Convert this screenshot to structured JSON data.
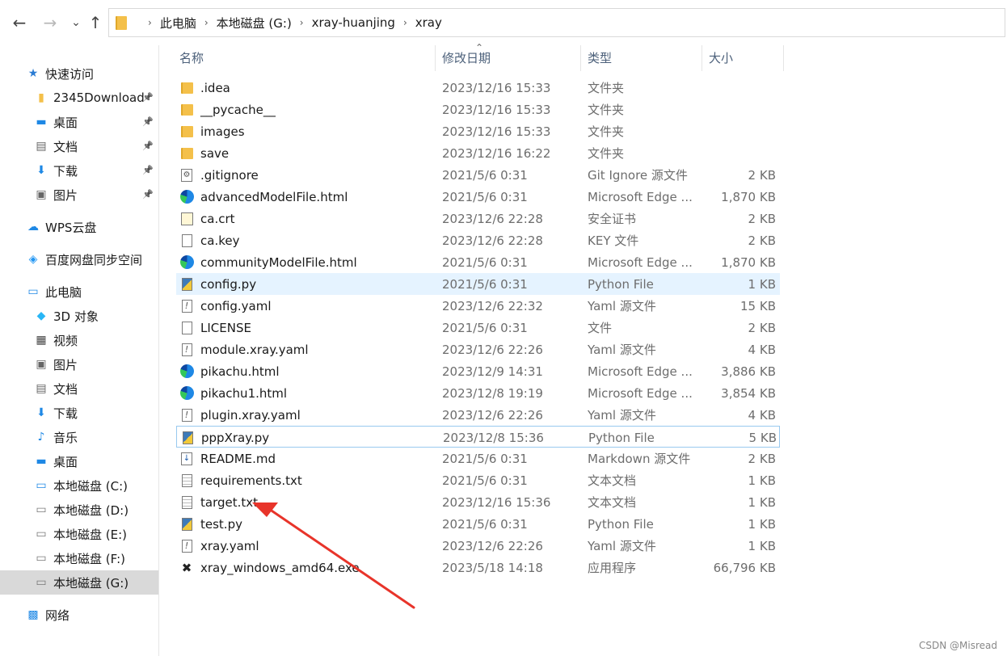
{
  "breadcrumb": [
    "此电脑",
    "本地磁盘 (G:)",
    "xray-huanjing",
    "xray"
  ],
  "nav": {
    "back": "←",
    "forward": "→",
    "recent": "⌄",
    "up": "↑"
  },
  "sidebar": {
    "items": [
      {
        "label": "快速访问",
        "icon": "star-icon",
        "glyph": "★",
        "color": "#2b7cd3",
        "indent": 32,
        "pinned": false
      },
      {
        "label": "2345Download",
        "icon": "folder-icon",
        "glyph": "▮",
        "color": "#f4c04a",
        "indent": 42,
        "pinned": true
      },
      {
        "label": "桌面",
        "icon": "desktop-icon",
        "glyph": "▬",
        "color": "#1e88e5",
        "indent": 42,
        "pinned": true
      },
      {
        "label": "文档",
        "icon": "document-icon",
        "glyph": "▤",
        "color": "#666666",
        "indent": 42,
        "pinned": true
      },
      {
        "label": "下载",
        "icon": "download-icon",
        "glyph": "⬇",
        "color": "#1e88e5",
        "indent": 42,
        "pinned": true
      },
      {
        "label": "图片",
        "icon": "picture-icon",
        "glyph": "▣",
        "color": "#666666",
        "indent": 42,
        "pinned": true
      },
      {
        "label": "WPS云盘",
        "icon": "cloud-icon",
        "glyph": "☁",
        "color": "#1e88e5",
        "indent": 32,
        "pinned": false
      },
      {
        "label": "百度网盘同步空间",
        "icon": "baidu-sync-icon",
        "glyph": "◈",
        "color": "#2196f3",
        "indent": 32,
        "pinned": false
      },
      {
        "label": "此电脑",
        "icon": "computer-icon",
        "glyph": "▭",
        "color": "#1e88e5",
        "indent": 32,
        "pinned": false
      },
      {
        "label": "3D 对象",
        "icon": "3d-objects-icon",
        "glyph": "◆",
        "color": "#29b6f6",
        "indent": 42,
        "pinned": false
      },
      {
        "label": "视频",
        "icon": "video-icon",
        "glyph": "▦",
        "color": "#444444",
        "indent": 42,
        "pinned": false
      },
      {
        "label": "图片",
        "icon": "picture-icon",
        "glyph": "▣",
        "color": "#666666",
        "indent": 42,
        "pinned": false
      },
      {
        "label": "文档",
        "icon": "document-icon",
        "glyph": "▤",
        "color": "#666666",
        "indent": 42,
        "pinned": false
      },
      {
        "label": "下载",
        "icon": "download-icon",
        "glyph": "⬇",
        "color": "#1e88e5",
        "indent": 42,
        "pinned": false
      },
      {
        "label": "音乐",
        "icon": "music-icon",
        "glyph": "♪",
        "color": "#1e88e5",
        "indent": 42,
        "pinned": false
      },
      {
        "label": "桌面",
        "icon": "desktop-icon",
        "glyph": "▬",
        "color": "#1e88e5",
        "indent": 42,
        "pinned": false
      },
      {
        "label": "本地磁盘 (C:)",
        "icon": "drive-c-icon",
        "glyph": "▭",
        "color": "#1e88e5",
        "indent": 42,
        "pinned": false
      },
      {
        "label": "本地磁盘 (D:)",
        "icon": "drive-icon",
        "glyph": "▭",
        "color": "#777777",
        "indent": 42,
        "pinned": false
      },
      {
        "label": "本地磁盘 (E:)",
        "icon": "drive-icon",
        "glyph": "▭",
        "color": "#777777",
        "indent": 42,
        "pinned": false
      },
      {
        "label": "本地磁盘 (F:)",
        "icon": "drive-icon",
        "glyph": "▭",
        "color": "#777777",
        "indent": 42,
        "pinned": false
      },
      {
        "label": "本地磁盘 (G:)",
        "icon": "drive-icon",
        "glyph": "▭",
        "color": "#777777",
        "indent": 42,
        "pinned": false,
        "selected": true
      },
      {
        "label": "网络",
        "icon": "network-icon",
        "glyph": "▩",
        "color": "#1e88e5",
        "indent": 32,
        "pinned": false
      }
    ]
  },
  "columns": {
    "name": "名称",
    "date": "修改日期",
    "type": "类型",
    "size": "大小"
  },
  "files": [
    {
      "name": ".idea",
      "date": "2023/12/16 15:33",
      "type": "文件夹",
      "size": "",
      "icon": "folder"
    },
    {
      "name": "__pycache__",
      "date": "2023/12/16 15:33",
      "type": "文件夹",
      "size": "",
      "icon": "folder"
    },
    {
      "name": "images",
      "date": "2023/12/16 15:33",
      "type": "文件夹",
      "size": "",
      "icon": "folder"
    },
    {
      "name": "save",
      "date": "2023/12/16 16:22",
      "type": "文件夹",
      "size": "",
      "icon": "folder"
    },
    {
      "name": ".gitignore",
      "date": "2021/5/6 0:31",
      "type": "Git Ignore 源文件",
      "size": "2 KB",
      "icon": "gear"
    },
    {
      "name": "advancedModelFile.html",
      "date": "2021/5/6 0:31",
      "type": "Microsoft Edge ...",
      "size": "1,870 KB",
      "icon": "edge"
    },
    {
      "name": "ca.crt",
      "date": "2023/12/6 22:28",
      "type": "安全证书",
      "size": "2 KB",
      "icon": "cert"
    },
    {
      "name": "ca.key",
      "date": "2023/12/6 22:28",
      "type": "KEY 文件",
      "size": "2 KB",
      "icon": "doc"
    },
    {
      "name": "communityModelFile.html",
      "date": "2021/5/6 0:31",
      "type": "Microsoft Edge ...",
      "size": "1,870 KB",
      "icon": "edge"
    },
    {
      "name": "config.py",
      "date": "2021/5/6 0:31",
      "type": "Python File",
      "size": "1 KB",
      "icon": "py",
      "state": "hover"
    },
    {
      "name": "config.yaml",
      "date": "2023/12/6 22:32",
      "type": "Yaml 源文件",
      "size": "15 KB",
      "icon": "yaml"
    },
    {
      "name": "LICENSE",
      "date": "2021/5/6 0:31",
      "type": "文件",
      "size": "2 KB",
      "icon": "doc"
    },
    {
      "name": "module.xray.yaml",
      "date": "2023/12/6 22:26",
      "type": "Yaml 源文件",
      "size": "4 KB",
      "icon": "yaml"
    },
    {
      "name": "pikachu.html",
      "date": "2023/12/9 14:31",
      "type": "Microsoft Edge ...",
      "size": "3,886 KB",
      "icon": "edge"
    },
    {
      "name": "pikachu1.html",
      "date": "2023/12/8 19:19",
      "type": "Microsoft Edge ...",
      "size": "3,854 KB",
      "icon": "edge"
    },
    {
      "name": "plugin.xray.yaml",
      "date": "2023/12/6 22:26",
      "type": "Yaml 源文件",
      "size": "4 KB",
      "icon": "yaml"
    },
    {
      "name": "pppXray.py",
      "date": "2023/12/8 15:36",
      "type": "Python File",
      "size": "5 KB",
      "icon": "py",
      "state": "focus"
    },
    {
      "name": "README.md",
      "date": "2021/5/6 0:31",
      "type": "Markdown 源文件",
      "size": "2 KB",
      "icon": "md"
    },
    {
      "name": "requirements.txt",
      "date": "2021/5/6 0:31",
      "type": "文本文档",
      "size": "1 KB",
      "icon": "txt"
    },
    {
      "name": "target.txt",
      "date": "2023/12/16 15:36",
      "type": "文本文档",
      "size": "1 KB",
      "icon": "txt"
    },
    {
      "name": "test.py",
      "date": "2021/5/6 0:31",
      "type": "Python File",
      "size": "1 KB",
      "icon": "py"
    },
    {
      "name": "xray.yaml",
      "date": "2023/12/6 22:26",
      "type": "Yaml 源文件",
      "size": "1 KB",
      "icon": "yaml"
    },
    {
      "name": "xray_windows_amd64.exe",
      "date": "2023/5/18 14:18",
      "type": "应用程序",
      "size": "66,796 KB",
      "icon": "exe"
    }
  ],
  "annotation": {
    "color": "#e8342a",
    "points_to": "target.txt"
  },
  "watermark": "CSDN @Misread"
}
